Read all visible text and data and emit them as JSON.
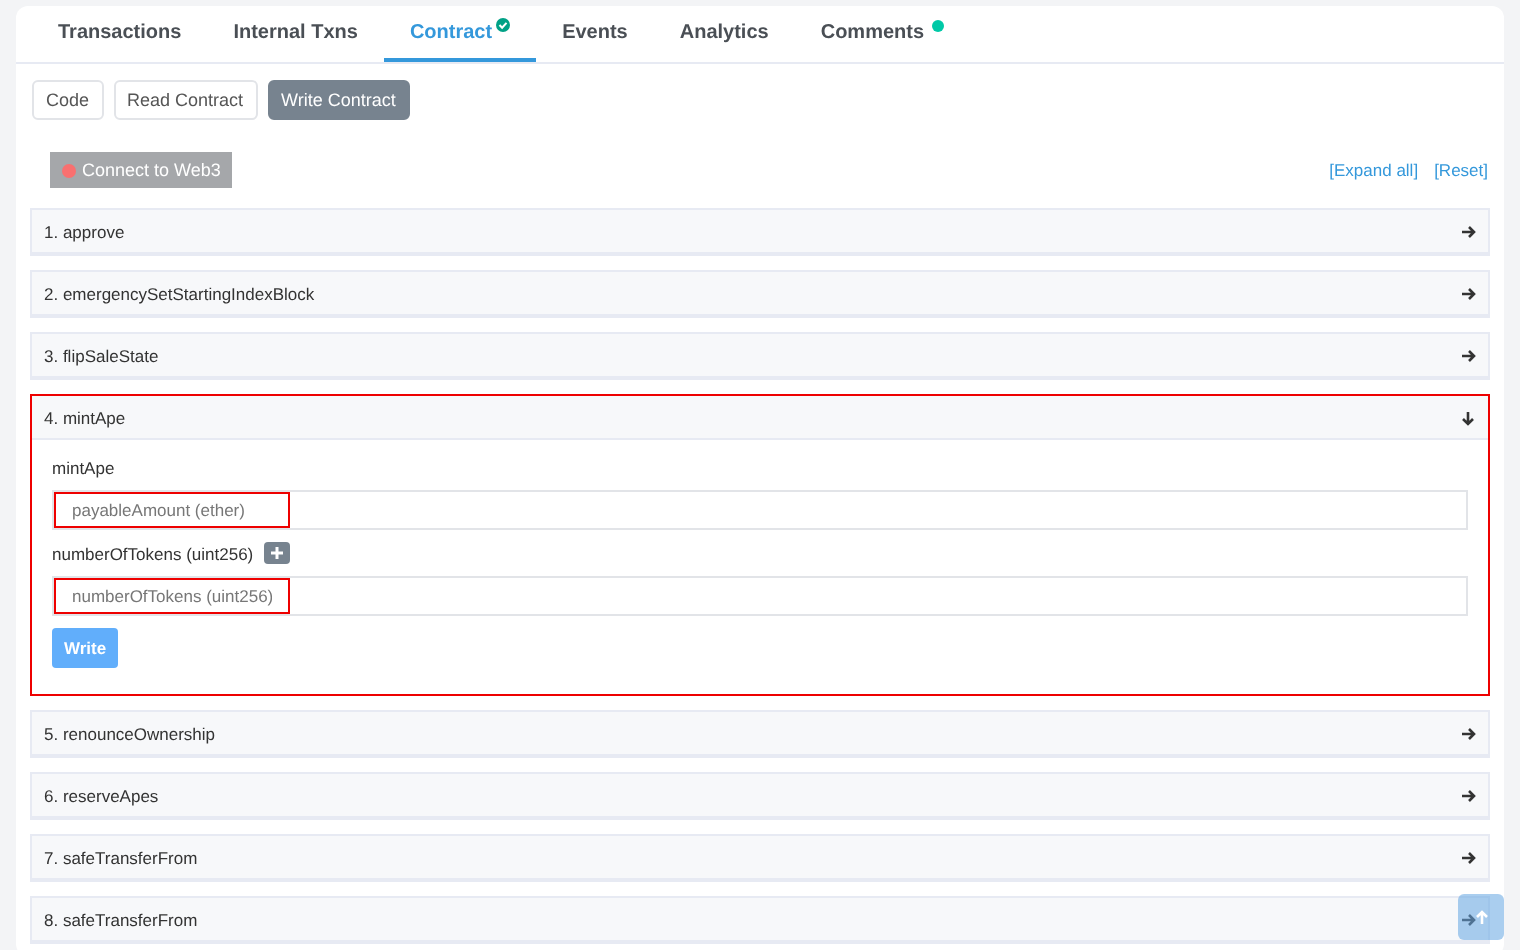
{
  "tabs": [
    {
      "label": "Transactions",
      "selected": false,
      "verified": false,
      "new_dot": false
    },
    {
      "label": "Internal Txns",
      "selected": false,
      "verified": false,
      "new_dot": false
    },
    {
      "label": "Contract",
      "selected": true,
      "verified": true,
      "new_dot": false
    },
    {
      "label": "Events",
      "selected": false,
      "verified": false,
      "new_dot": false
    },
    {
      "label": "Analytics",
      "selected": false,
      "verified": false,
      "new_dot": false
    },
    {
      "label": "Comments",
      "selected": false,
      "verified": false,
      "new_dot": true
    }
  ],
  "subtabs": [
    {
      "label": "Code",
      "selected": false
    },
    {
      "label": "Read Contract",
      "selected": false
    },
    {
      "label": "Write Contract",
      "selected": true
    }
  ],
  "connect_button": {
    "label": "Connect to Web3",
    "connected": false
  },
  "links": [
    "[Expand all]",
    "[Reset]"
  ],
  "functions": [
    {
      "title": "1. approve",
      "expanded": false,
      "highlighted": false
    },
    {
      "title": "2. emergencySetStartingIndexBlock",
      "expanded": false,
      "highlighted": false
    },
    {
      "title": "3. flipSaleState",
      "expanded": false,
      "highlighted": false
    },
    {
      "title": "4. mintApe",
      "expanded": true,
      "highlighted": true,
      "body": {
        "heading": "mintApe",
        "fields": [
          {
            "placeholder": "payableAmount (ether)",
            "highlighted": true
          },
          {
            "label": "numberOfTokens (uint256)",
            "placeholder": "numberOfTokens (uint256)",
            "highlighted": true
          }
        ],
        "button": "Write"
      }
    },
    {
      "title": "5. renounceOwnership",
      "expanded": false,
      "highlighted": false
    },
    {
      "title": "6. reserveApes",
      "expanded": false,
      "highlighted": false
    },
    {
      "title": "7. safeTransferFrom",
      "expanded": false,
      "highlighted": false
    },
    {
      "title": "8. safeTransferFrom",
      "expanded": false,
      "highlighted": false
    }
  ]
}
